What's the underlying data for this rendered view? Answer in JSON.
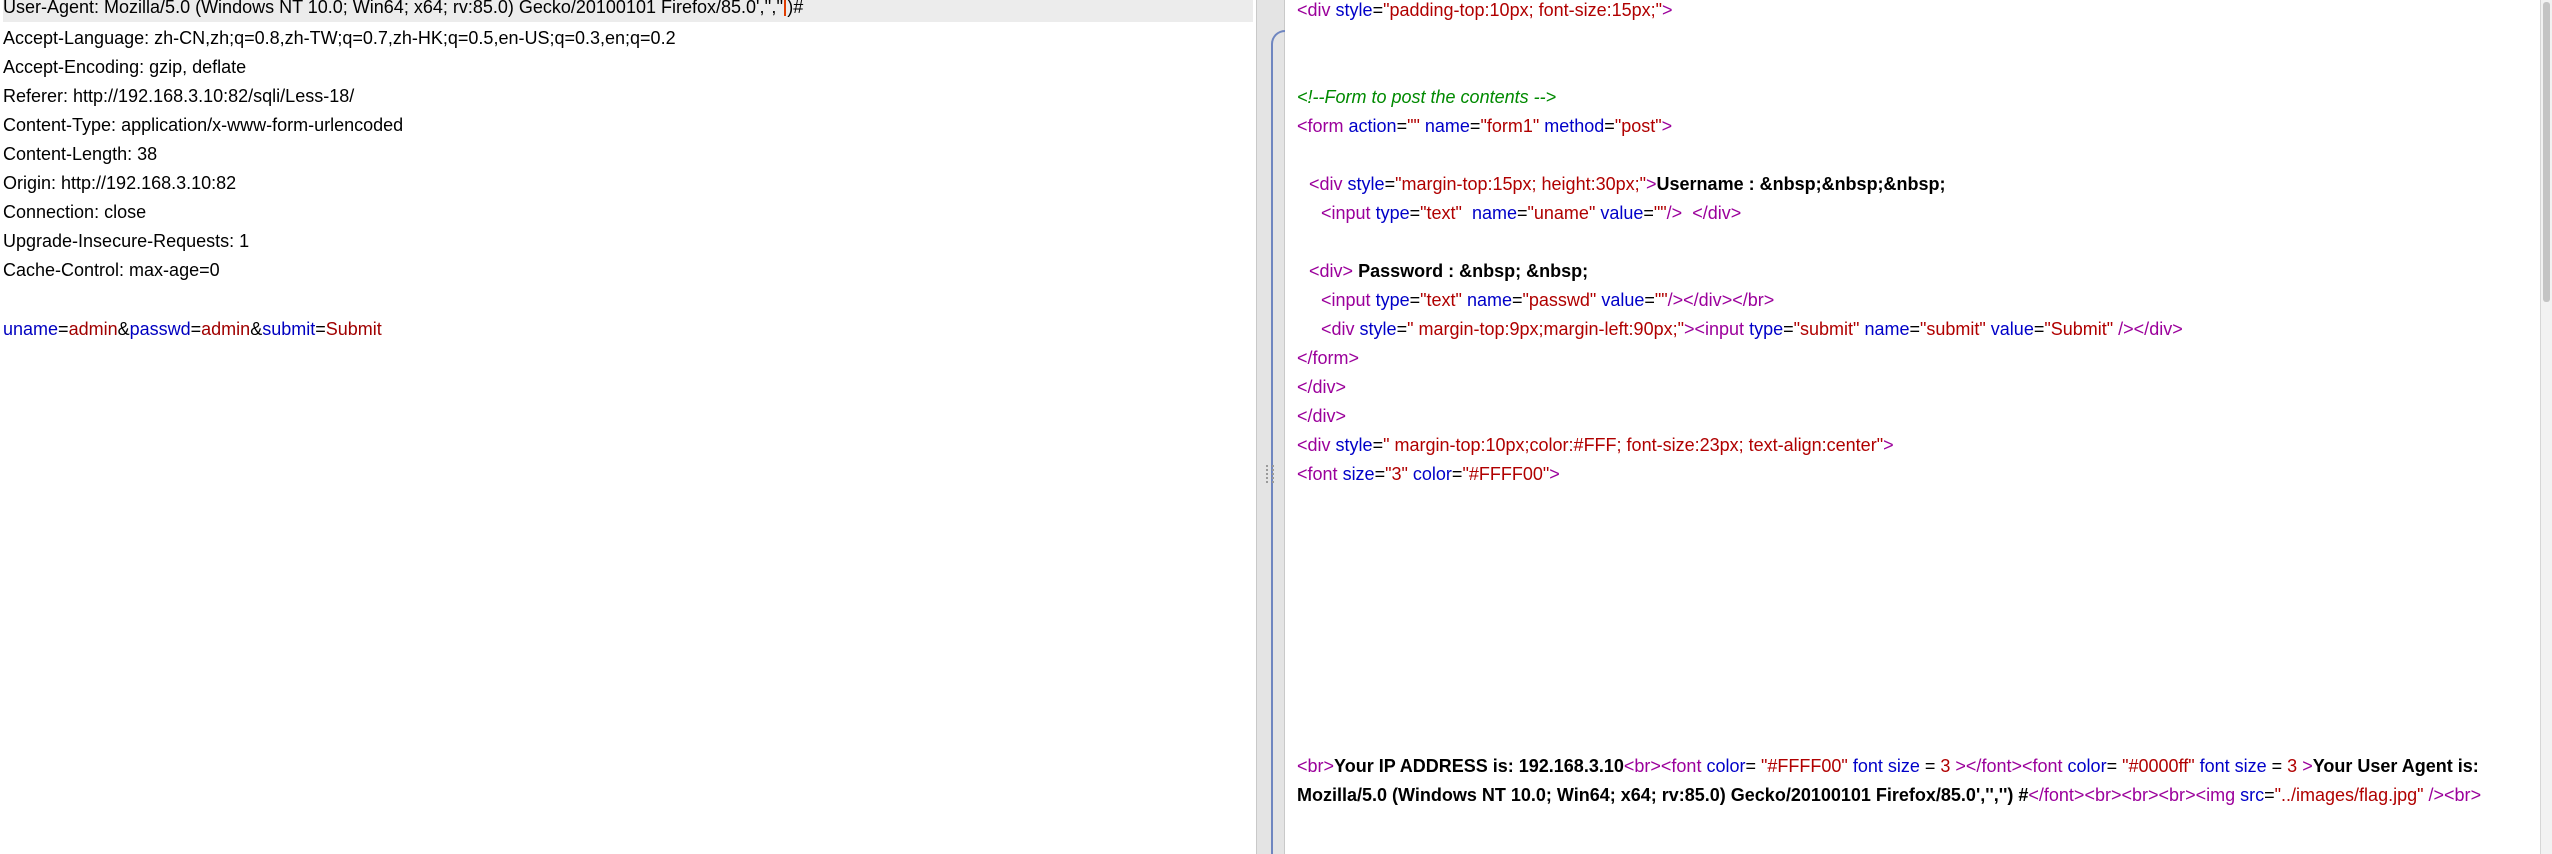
{
  "request": {
    "ua_prefix": "User-Agent: Mozilla/5.0 (Windows NT 10.0; Win64; x64; rv:85.0) Gecko/20100101 Firefox/85.0','',''",
    "ua_suffix": ")#",
    "headers": [
      "Accept-Language: zh-CN,zh;q=0.8,zh-TW;q=0.7,zh-HK;q=0.5,en-US;q=0.3,en;q=0.2",
      "Accept-Encoding: gzip, deflate",
      "Referer: http://192.168.3.10:82/sqli/Less-18/",
      "Content-Type: application/x-www-form-urlencoded",
      "Content-Length: 38",
      "Origin: http://192.168.3.10:82",
      "Connection: close",
      "Upgrade-Insecure-Requests: 1",
      "Cache-Control: max-age=0"
    ],
    "body_params": [
      {
        "key": "uname",
        "value": "admin"
      },
      {
        "key": "passwd",
        "value": "admin"
      },
      {
        "key": "submit",
        "value": "Submit"
      }
    ]
  },
  "response": {
    "s": {
      "lt": "<",
      "gt": ">",
      "eq": "=",
      "q": "\"",
      "sp": " ",
      "slgt": "/>",
      "sslgt": " />",
      "ltsl": "</"
    },
    "line1": {
      "tag": "div",
      "attr": "style",
      "val": "padding-top:10px; font-size:15px;"
    },
    "comment": "<!--Form to post the contents -->",
    "form": {
      "tag": "form",
      "a1": "action",
      "v1": "",
      "a2": "name",
      "v2": "form1",
      "a3": "method",
      "v3": "post"
    },
    "div_user": {
      "tag": "div",
      "attr": "style",
      "val": "margin-top:15px; height:30px;",
      "text": "Username : &nbsp;&nbsp;&nbsp;"
    },
    "input_user": {
      "tag": "input",
      "a1": "type",
      "v1": "text",
      "a2": "name",
      "v2": "uname",
      "a3": "value",
      "v3": "",
      "close_tag": "div"
    },
    "div_pass": {
      "tag": "div",
      "text": "Password : &nbsp; &nbsp;"
    },
    "input_pass": {
      "tag": "input",
      "a1": "type",
      "v1": "text",
      "a2": "name",
      "v2": "passwd",
      "a3": "value",
      "v3": "",
      "close_div": "div",
      "br": "br"
    },
    "div_submit": {
      "tag": "div",
      "attr": "style",
      "val": " margin-top:9px;margin-left:90px;",
      "itag": "input",
      "a1": "type",
      "v1": "submit",
      "a2": "name",
      "v2": "submit",
      "a3": "value",
      "v3": "Submit",
      "close": "div"
    },
    "close_form": "form",
    "close_div1": "div",
    "close_div2": "div",
    "div_center": {
      "tag": "div",
      "attr": "style",
      "val": " margin-top:10px;color:#FFF; font-size:23px; text-align:center"
    },
    "font_line": {
      "tag": "font",
      "a1": "size",
      "v1": "3",
      "a2": "color",
      "v2": "#FFFF00"
    },
    "result": {
      "br": "br",
      "ip_text": "Your IP ADDRESS is: 192.168.3.10",
      "font1": "font",
      "color_attr": "color",
      "color1": "#FFFF00",
      "size_attr": "font size",
      "size_val": "3",
      "color2": "#0000ff",
      "ua_text": "Your User Agent is: Mozilla/5.0 (Windows NT 10.0; Win64; x64; rv:85.0) Gecko/20100101 Firefox/85.0','',''",
      "hash": ") #",
      "img": "img",
      "src_attr": "src",
      "src_val": "../images/flag.jpg",
      "size_eq_a": " = ",
      "size_eq_b": " ",
      "color_eq": "= "
    }
  }
}
